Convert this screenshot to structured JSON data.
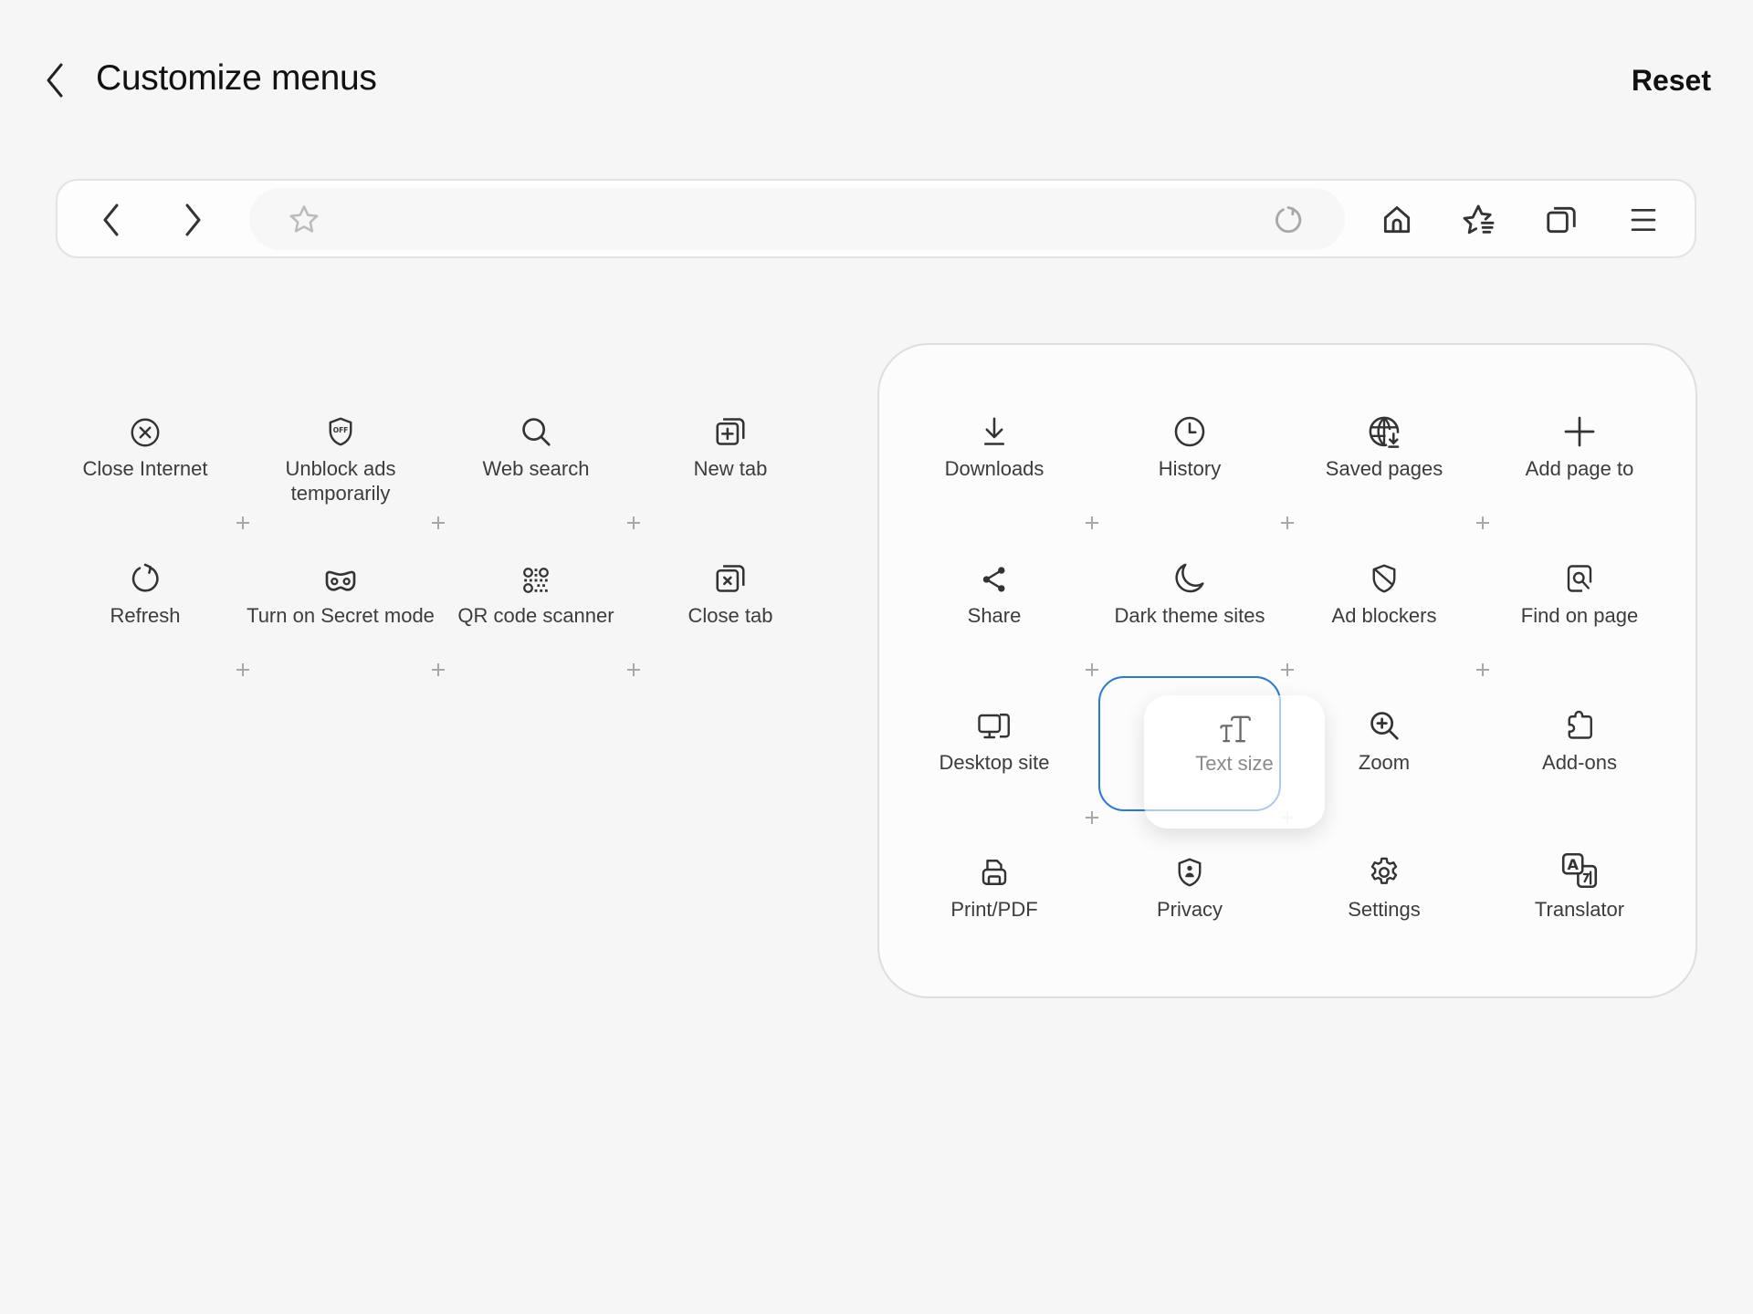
{
  "header": {
    "title": "Customize menus",
    "reset_label": "Reset",
    "back_icon": "chevron-left-icon"
  },
  "toolbar": {
    "icons": [
      "back-arrow-icon",
      "forward-arrow-icon",
      "bookmark-star-icon",
      "reload-icon",
      "home-icon",
      "bookmarks-list-icon",
      "tabs-icon",
      "menu-icon"
    ]
  },
  "available_items": [
    {
      "label": "Close Internet",
      "icon": "close-circle-icon"
    },
    {
      "label": "Unblock ads temporarily",
      "icon": "shield-off-icon"
    },
    {
      "label": "Web search",
      "icon": "search-icon"
    },
    {
      "label": "New tab",
      "icon": "new-tab-icon"
    },
    {
      "label": "Refresh",
      "icon": "refresh-icon"
    },
    {
      "label": "Turn on Secret mode",
      "icon": "secret-mask-icon"
    },
    {
      "label": "QR code scanner",
      "icon": "qr-code-icon"
    },
    {
      "label": "Close tab",
      "icon": "close-tab-icon"
    }
  ],
  "menu_panel_items": [
    {
      "label": "Downloads",
      "icon": "download-icon"
    },
    {
      "label": "History",
      "icon": "clock-icon"
    },
    {
      "label": "Saved pages",
      "icon": "globe-download-icon"
    },
    {
      "label": "Add page to",
      "icon": "plus-icon"
    },
    {
      "label": "Share",
      "icon": "share-icon"
    },
    {
      "label": "Dark theme sites",
      "icon": "moon-icon"
    },
    {
      "label": "Ad blockers",
      "icon": "ad-block-shield-icon"
    },
    {
      "label": "Find on page",
      "icon": "find-on-page-icon"
    },
    {
      "label": "Desktop site",
      "icon": "desktop-icon"
    },
    {
      "label": "Zoom",
      "icon": "zoom-in-icon"
    },
    {
      "label": "Add-ons",
      "icon": "puzzle-icon"
    },
    {
      "label": "Print/PDF",
      "icon": "printer-icon"
    },
    {
      "label": "Privacy",
      "icon": "privacy-shield-icon"
    },
    {
      "label": "Settings",
      "icon": "gear-icon"
    },
    {
      "label": "Translator",
      "icon": "translate-icon"
    }
  ],
  "dragging_item": {
    "label": "Text size",
    "icon": "text-size-icon"
  },
  "colors": {
    "accent": "#2a7ad6",
    "background": "#f6f6f6",
    "panel": "#fcfcfc"
  }
}
